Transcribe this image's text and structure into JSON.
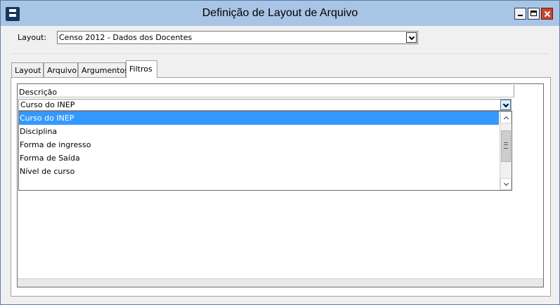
{
  "window": {
    "title": "Definição de Layout de Arquivo"
  },
  "layout_field": {
    "label": "Layout:",
    "value": "Censo 2012 - Dados dos Docentes"
  },
  "tabs": [
    {
      "label": "Layout"
    },
    {
      "label": "Arquivo"
    },
    {
      "label": "Argumentos"
    },
    {
      "label": "Filtros",
      "active": true
    }
  ],
  "grid": {
    "column_header": "Descrição",
    "current_value": "Curso do INEP",
    "options": [
      "Curso do INEP",
      "Disciplina",
      "Forma de ingresso",
      "Forma de Saída",
      "Nível de curso"
    ],
    "selected_index": 0
  },
  "colors": {
    "titlebar": "#a9c5e6",
    "selection": "#3399ff",
    "close_button": "#c7462f"
  },
  "icons": {
    "app": "app-logo-icon",
    "minimize": "minimize-icon",
    "maximize": "maximize-icon",
    "close": "close-icon",
    "dropdown": "chevron-down-icon"
  }
}
